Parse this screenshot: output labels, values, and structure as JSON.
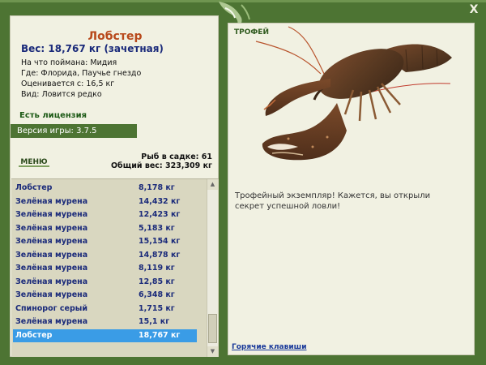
{
  "window": {
    "close_label": "X"
  },
  "fish": {
    "name": "Лобстер",
    "weight": "Вес: 18,767 кг (зачетная)",
    "info": [
      "На что поймана: Мидия",
      "Где: Флорида, Паучье гнездо",
      "Оценивается с: 16,5 кг",
      "Вид: Ловится редко"
    ]
  },
  "license": "Есть лицензия",
  "version": "Версия игры: 3.7.5",
  "menu": "МЕНЮ",
  "stats": {
    "count": "Рыб в садке: 61",
    "total": "Общий вес: 323,309 кг"
  },
  "catch_list": [
    {
      "name": "Лобстер",
      "weight": "8,178 кг"
    },
    {
      "name": "Зелёная мурена",
      "weight": "14,432 кг"
    },
    {
      "name": "Зелёная мурена",
      "weight": "12,423 кг"
    },
    {
      "name": "Зелёная мурена",
      "weight": "5,183 кг"
    },
    {
      "name": "Зелёная мурена",
      "weight": "15,154 кг"
    },
    {
      "name": "Зелёная мурена",
      "weight": "14,878 кг"
    },
    {
      "name": "Зелёная мурена",
      "weight": "8,119 кг"
    },
    {
      "name": "Зелёная мурена",
      "weight": "12,85 кг"
    },
    {
      "name": "Зелёная мурена",
      "weight": "6,348 кг"
    },
    {
      "name": "Спинорог серый",
      "weight": "1,715 кг"
    },
    {
      "name": "Зелёная мурена",
      "weight": "15,1 кг"
    },
    {
      "name": "Лобстер",
      "weight": "18,767 кг"
    }
  ],
  "selected_index": 11,
  "trophy": {
    "title": "ТРОФЕЙ",
    "text": "Трофейный экземпляр! Кажется, вы открыли секрет успешной ловли!"
  },
  "hotkeys": "Горячие клавиши",
  "colors": {
    "frame": "#4d7433",
    "panel": "#f1f1e2",
    "list_bg": "#d9d7c0",
    "selection": "#3a9ce6",
    "fish_name": "#b8491b",
    "text_blue": "#1a2a7a"
  }
}
